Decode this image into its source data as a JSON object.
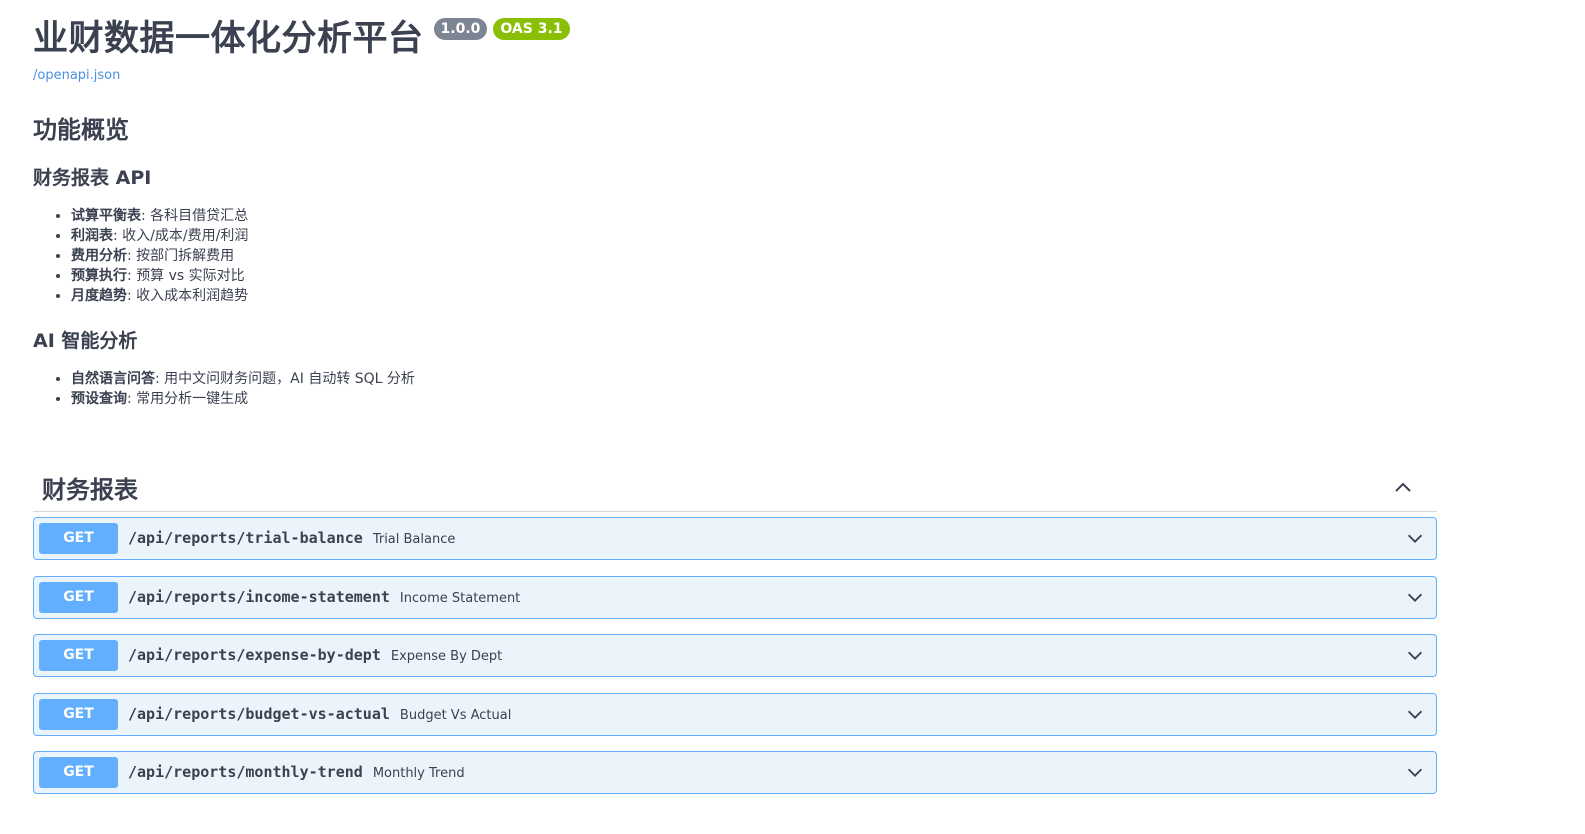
{
  "header": {
    "title": "业财数据一体化分析平台",
    "version_badge": "1.0.0",
    "oas_badge": "OAS 3.1",
    "spec_link": "/openapi.json"
  },
  "description": {
    "heading": "功能概览",
    "reports_heading": "财务报表 API",
    "reports_items": [
      {
        "name": "试算平衡表",
        "desc": ": 各科目借贷汇总"
      },
      {
        "name": "利润表",
        "desc": ": 收入/成本/费用/利润"
      },
      {
        "name": "费用分析",
        "desc": ": 按部门拆解费用"
      },
      {
        "name": "预算执行",
        "desc": ": 预算 vs 实际对比"
      },
      {
        "name": "月度趋势",
        "desc": ": 收入成本利润趋势"
      }
    ],
    "ai_heading": "AI 智能分析",
    "ai_items": [
      {
        "name": "自然语言问答",
        "desc": ": 用中文问财务问题，AI 自动转 SQL 分析"
      },
      {
        "name": "预设查询",
        "desc": ": 常用分析一键生成"
      }
    ]
  },
  "section": {
    "title": "财务报表",
    "expanded": true,
    "operations": [
      {
        "method": "GET",
        "path": "/api/reports/trial-balance",
        "summary": "Trial Balance"
      },
      {
        "method": "GET",
        "path": "/api/reports/income-statement",
        "summary": "Income Statement"
      },
      {
        "method": "GET",
        "path": "/api/reports/expense-by-dept",
        "summary": "Expense By Dept"
      },
      {
        "method": "GET",
        "path": "/api/reports/budget-vs-actual",
        "summary": "Budget Vs Actual"
      },
      {
        "method": "GET",
        "path": "/api/reports/monthly-trend",
        "summary": "Monthly Trend"
      }
    ]
  },
  "colors": {
    "get_method": "#61affe",
    "get_background": "#ebf3fb",
    "version_badge": "#7d8492",
    "oas_badge": "#89bf04",
    "link": "#4990e2"
  }
}
